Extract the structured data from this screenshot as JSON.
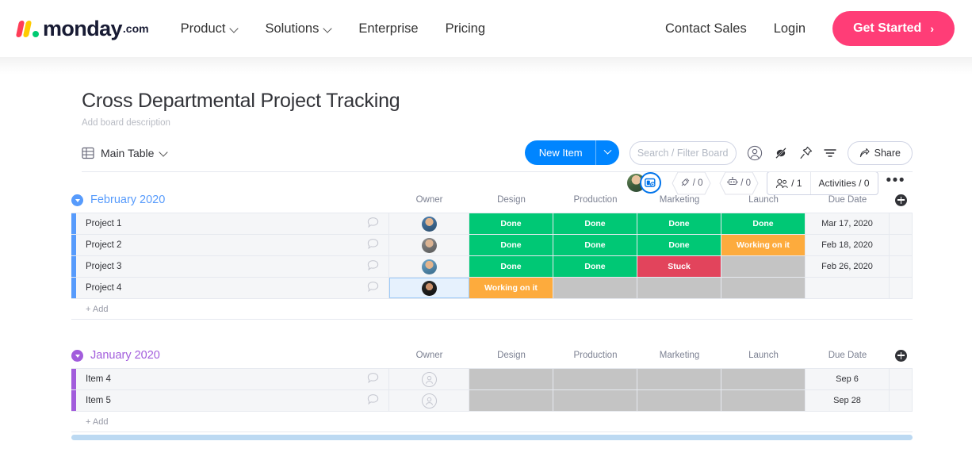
{
  "nav": {
    "logo_text": "monday",
    "logo_suffix": ".com",
    "links": [
      {
        "label": "Product",
        "has_caret": true
      },
      {
        "label": "Solutions",
        "has_caret": true
      },
      {
        "label": "Enterprise",
        "has_caret": false
      },
      {
        "label": "Pricing",
        "has_caret": false
      }
    ],
    "contact_sales": "Contact Sales",
    "login": "Login",
    "get_started": "Get Started",
    "get_started_arrow": "›",
    "brand_pink": "#ff3d77"
  },
  "board": {
    "title": "Cross Departmental Project Tracking",
    "description_placeholder": "Add board description",
    "integrations_count": "/ 0",
    "automations_count": "/ 0",
    "people_count": "/ 1",
    "activities_label": "Activities / 0",
    "more_dots": "•••"
  },
  "toolbar": {
    "tab_label": "Main Table",
    "new_item_label": "New Item",
    "search_placeholder": "Search / Filter Board",
    "share_label": "Share",
    "icons": [
      "person-icon",
      "hide-icon",
      "pin-icon",
      "filter-icon"
    ]
  },
  "table": {
    "columns": [
      "Owner",
      "Design",
      "Production",
      "Marketing",
      "Launch",
      "Due Date"
    ],
    "add_label": "+ Add",
    "groups": [
      {
        "name": "February 2020",
        "color": "#579bfc",
        "rows": [
          {
            "name": "Project 1",
            "owner": "avatar-m1",
            "owner_selected": false,
            "design": "Done",
            "production": "Done",
            "marketing": "Done",
            "launch": "Done",
            "due_date": "Mar 17, 2020"
          },
          {
            "name": "Project 2",
            "owner": "avatar-m2",
            "owner_selected": false,
            "design": "Done",
            "production": "Done",
            "marketing": "Done",
            "launch": "Working on it",
            "due_date": "Feb 18, 2020"
          },
          {
            "name": "Project 3",
            "owner": "avatar-m3",
            "owner_selected": false,
            "design": "Done",
            "production": "Done",
            "marketing": "Stuck",
            "launch": "",
            "due_date": "Feb 26, 2020"
          },
          {
            "name": "Project 4",
            "owner": "avatar-f1",
            "owner_selected": true,
            "design": "Working on it",
            "production": "",
            "marketing": "",
            "launch": "",
            "due_date": ""
          }
        ]
      },
      {
        "name": "January 2020",
        "color": "#a25ddc",
        "rows": [
          {
            "name": "Item 4",
            "owner": "avatar-empty",
            "owner_selected": false,
            "design": "",
            "production": "",
            "marketing": "",
            "launch": "",
            "due_date": "Sep 6"
          },
          {
            "name": "Item 5",
            "owner": "avatar-empty",
            "owner_selected": false,
            "design": "",
            "production": "",
            "marketing": "",
            "launch": "",
            "due_date": "Sep 28"
          }
        ]
      }
    ],
    "status_colors": {
      "Done": "#00c875",
      "Working on it": "#fdab3d",
      "Stuck": "#e2445c",
      "empty": "#c4c4c4"
    }
  }
}
